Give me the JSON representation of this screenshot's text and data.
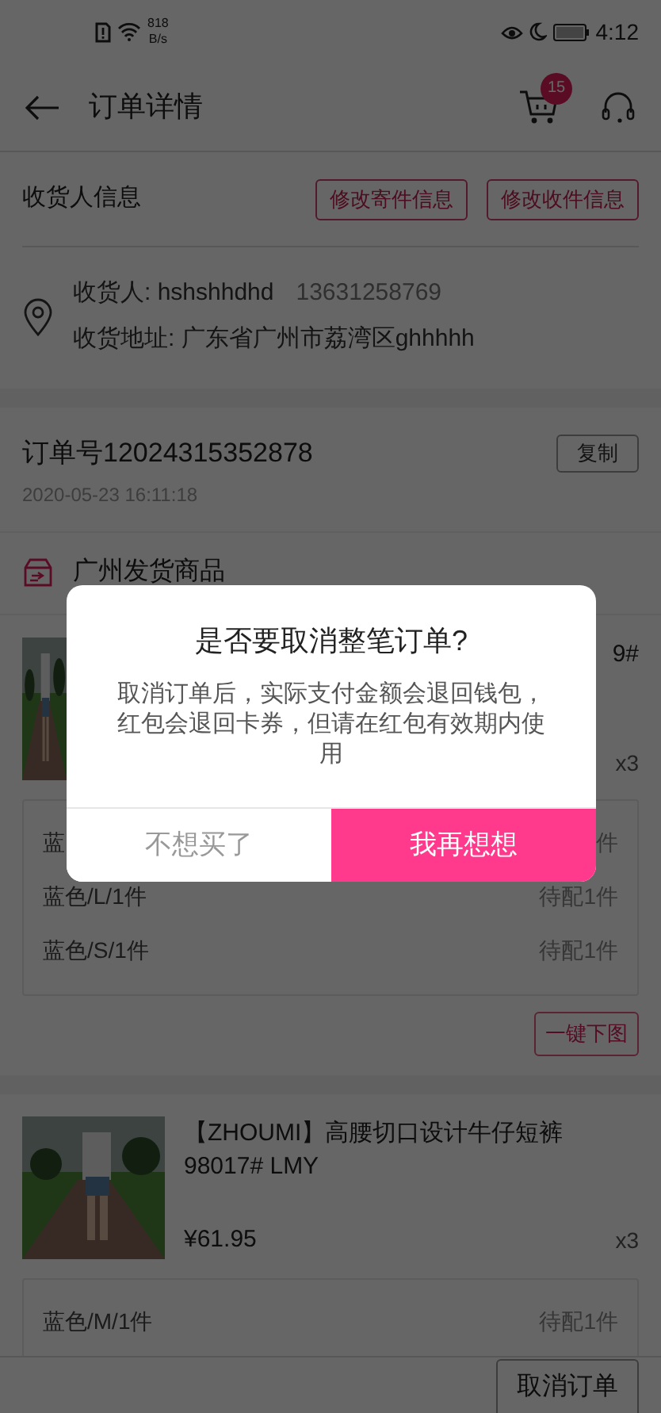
{
  "status_bar": {
    "net_speed": "818",
    "net_unit": "B/s",
    "time": "4:12"
  },
  "header": {
    "title": "订单详情",
    "cart_badge": "15"
  },
  "receiver": {
    "label": "收货人信息",
    "buttons": [
      "修改寄件信息",
      "修改收件信息"
    ],
    "name_line": "收货人: hshshhdhd",
    "phone": "13631258769",
    "address": "收货地址: 广东省广州市荔湾区ghhhhh"
  },
  "order": {
    "number": "订单号12024315352878",
    "copy_button": "复制",
    "time": "2020-05-23 16:11:18"
  },
  "shipment": {
    "title": "广州发货商品"
  },
  "products": [
    {
      "title": "9#",
      "quantity": "x3",
      "variants": [
        {
          "spec": "蓝",
          "status": "件"
        },
        {
          "spec": "蓝色/L/1件",
          "status": "待配1件"
        },
        {
          "spec": "蓝色/S/1件",
          "status": "待配1件"
        }
      ],
      "action": "一键下图"
    },
    {
      "title": "【ZHOUMI】高腰切口设计牛仔短裤98017# LMY",
      "price": "¥61.95",
      "quantity": "x3",
      "variants": [
        {
          "spec": "蓝色/M/1件",
          "status": "待配1件"
        }
      ]
    }
  ],
  "bottom_bar": {
    "button": "取消订单"
  },
  "dialog": {
    "title": "是否要取消整笔订单?",
    "message": "取消订单后，实际支付金额会退回钱包，红包会退回卡券，但请在红包有效期内使用",
    "buttons": [
      {
        "label": "不想买了",
        "kind": "secondary"
      },
      {
        "label": "我再想想",
        "kind": "primary"
      }
    ]
  }
}
